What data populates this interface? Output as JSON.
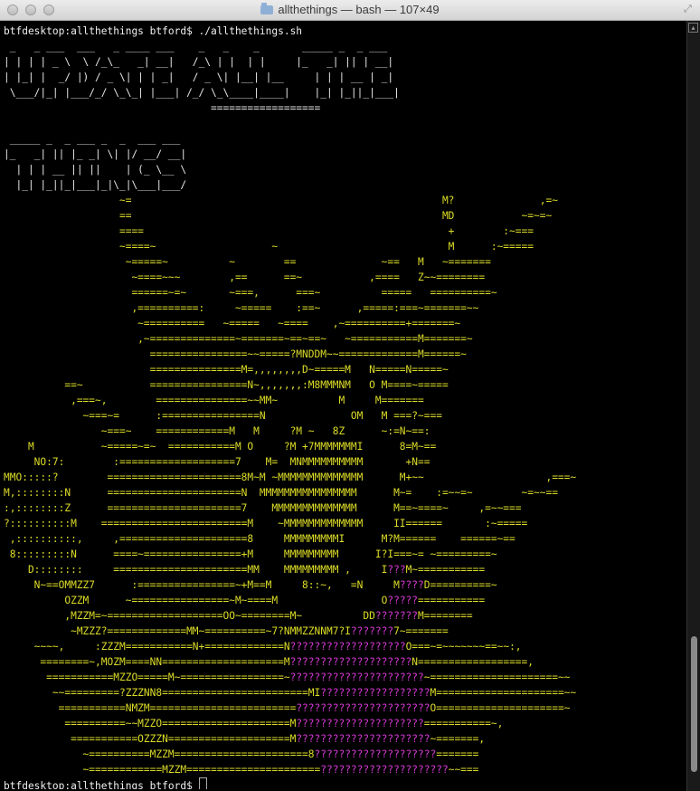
{
  "window": {
    "title": "allthethings — bash — 107×49"
  },
  "terminal": {
    "prompt_cmd": "btfdesktop:allthethings btford$ ./allthethings.sh",
    "prompt_end": "btfdesktop:allthethings btford$ ",
    "banner": [
      " _   _ ___  ___   _ ____ ___    _   _    _       _____ _  _ ___",
      "| | | | _ \\  \\ /_\\_   _| __|   /_\\ | |  | |     |_   _| || | __|",
      "| |_| |  _/ |) / _ \\| | | _|   / _ \\| |__| |__     | | | __ | _|",
      " \\___/|_| |___/_/ \\_\\_| |___| /_/ \\_\\____|____|    |_| |_||_|___|",
      "                                  ==================",
      "",
      " _____ _  _ ___ _  _  ___ ___",
      "|_   _| || |_ _| \\| |/ __/ __|",
      "  | | | __ || ||    | (_ \\__ \\",
      "  |_| |_||_|___|_|\\_|\\___|___/"
    ],
    "art": [
      "                   ~=                                                   M?              ,=~",
      "                   ==                                                   MD           ~=~=~",
      "                   ====                                                  +        :~===",
      "                   ~====~                   ~                            M      :~=====",
      "                    ~=====~          ~        ==              ~==   M   ~=======",
      "                     ~====~~~        ,==      ==~           ,====   Z~~========",
      "                     ======~=~       ~===,      ===~          =====   ==========~",
      "                     ,==========:     ~=====    :==~      ,=====:===~=======~~",
      "                      ~==========   ~=====   ~====    ,~==========+=======~",
      "                      ,~==============~=======~==~==~   ~===========M=======~",
      "                        ================~~=====?MNDDM~~=============M======~",
      "                        ===============M=,,,,,,,,D~=====M   N=====N=====~",
      "          ==~           ================N~,,,,,,,:M8MMMNM   O M====~=====",
      "           ,===~,        ===============~~MM~          M     M=======",
      "             ~===~=      :================N              OM   M ===?~===",
      "                ~===~    ============M   M     ?M ~   8Z      ~:=N~==:",
      "    M           ~=====~=~  ===========M O     ?M +7MMMMMMMI      8=M~==",
      "     NO:7:        :===================7    M=  MNMMMMMMMMMM       +N==",
      "MMO:::::?        ======================8M~M ~MMMMMMMMMMMMMM      M+~~                    ,===~",
      "M,::::::::N      ======================N  MMMMMMMMMMMMMMMM      M~=    :=~~=~        ~=~~==",
      ":,::::::::Z      ======================7    MMMMMMMMMMMMMM      M==~====~     ,=~~===",
      "?::::::::::M    ========================M    ~MMMMMMMMMMMMM     II======       :~=====",
      " ,::::::::::,     ,=====================8     MMMMMMMMMI      M?M======    ======~==",
      " 8:::::::::N      ====~================+M     MMMMMMMMM      I?I===~= ~=========~",
      "    D::::::::     ======================MM    MMMMMMMMM ,     I???M~===========",
      "     N~==OMMZZ7      :================~+M==M     8::~,   =N     M????D==========~",
      "          OZZM      ~================~M~====M                 O?????===========",
      "          ,MZZM=~===================OO~========M~          DD???????M========",
      "           ~MZZZ?=============MM~==========~7?NMMZZNNM7?I???????7~=======",
      "     ~~~~,     :ZZZM===========N+=============N???????????????????O===~=~~~~~~~==~~:,",
      "      ========~,MOZM====NN====================M????????????????????N==================,",
      "       ===========MZZO=====M~=================~??????????????????????~=====================~~",
      "        ~~=========?ZZZNN8========================MI??????????????????M=====================~~",
      "         ===========NMZM========================??????????????????????O=====================~",
      "          ==========~~MZZO=====================M?????????????????????===========~,",
      "           ===========OZZZN====================M??????????????????????~=======,",
      "             ~==========MZZM======================8????????????????????=======",
      "             ~============MZZM======================?????????????????????~~==="
    ]
  }
}
